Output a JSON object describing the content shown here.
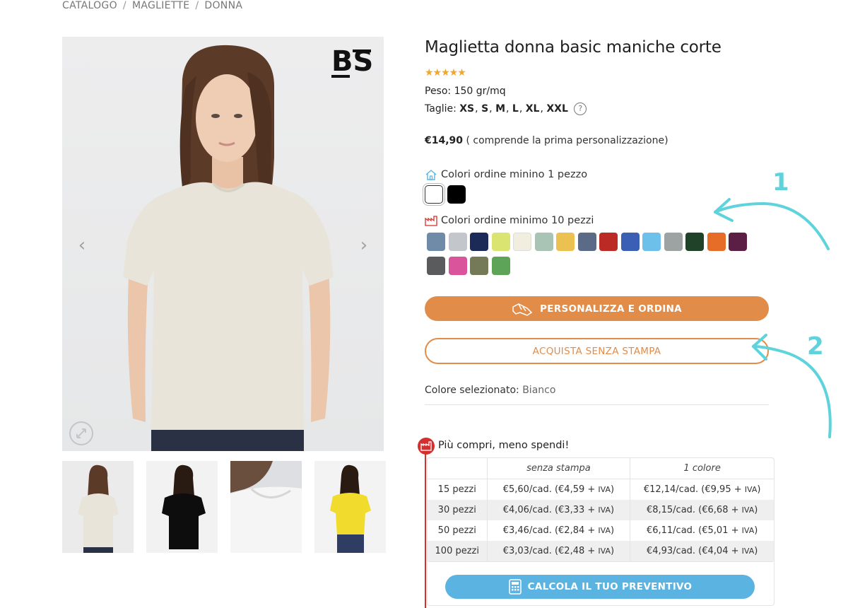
{
  "breadcrumb": [
    "CATALOGO",
    "MAGLIETTE",
    "DONNA"
  ],
  "product": {
    "title": "Maglietta donna basic maniche corte",
    "rating_stars": "★★★★★",
    "weight_label": "Peso: 150 gr/mq",
    "sizes_label": "Taglie:",
    "sizes": [
      "XS",
      "S",
      "M",
      "L",
      "XL",
      "XXL"
    ],
    "help": "?",
    "price": "€14,90",
    "price_note": " ( comprende la prima personalizzazione)"
  },
  "colors": {
    "min1_label": "Colori ordine minino 1 pezzo",
    "min1": [
      "#ffffff",
      "#000000"
    ],
    "min10_label": "Colori ordine minimo 10 pezzi",
    "min10": [
      "#6f8ba8",
      "#c3c7cc",
      "#1b2a57",
      "#d9e471",
      "#f2eedf",
      "#a9c3b4",
      "#ebc151",
      "#5b6a86",
      "#bb2a24",
      "#3a5fb5",
      "#6cc0ea",
      "#9da3a3",
      "#1f4229",
      "#e66d27",
      "#5b1f46",
      "#5a5b5c",
      "#d9549b",
      "#747958",
      "#5da458"
    ]
  },
  "buttons": {
    "customize": "PERSONALIZZA E ORDINA",
    "buy_blank": "ACQUISTA SENZA STAMPA",
    "calculate": "CALCOLA IL TUO PREVENTIVO"
  },
  "selected_color": {
    "label": "Colore selezionato: ",
    "value": "Bianco"
  },
  "annotations": [
    "1",
    "2"
  ],
  "gallery": {
    "logo": "BS"
  },
  "discount": {
    "title": "Più compri, meno spendi!",
    "headers": [
      "senza stampa",
      "1 colore"
    ],
    "rows": [
      {
        "qty": "15 pezzi",
        "a": "€5,60/cad. (€4,59 + ",
        "b": "€12,14/cad. (€9,95 + "
      },
      {
        "qty": "30 pezzi",
        "a": "€4,06/cad. (€3,33 + ",
        "b": "€8,15/cad. (€6,68 + "
      },
      {
        "qty": "50 pezzi",
        "a": "€3,46/cad. (€2,84 + ",
        "b": "€6,11/cad. (€5,01 + "
      },
      {
        "qty": "100 pezzi",
        "a": "€3,03/cad. (€2,48 + ",
        "b": "€4,93/cad. (€4,04 + "
      }
    ],
    "vat": "IVA",
    "close_paren": ")"
  },
  "accent": {
    "orange": "#e28c4a",
    "blue": "#5ab3e0",
    "red": "#d32f2f",
    "cyan": "#5fd3dc"
  }
}
